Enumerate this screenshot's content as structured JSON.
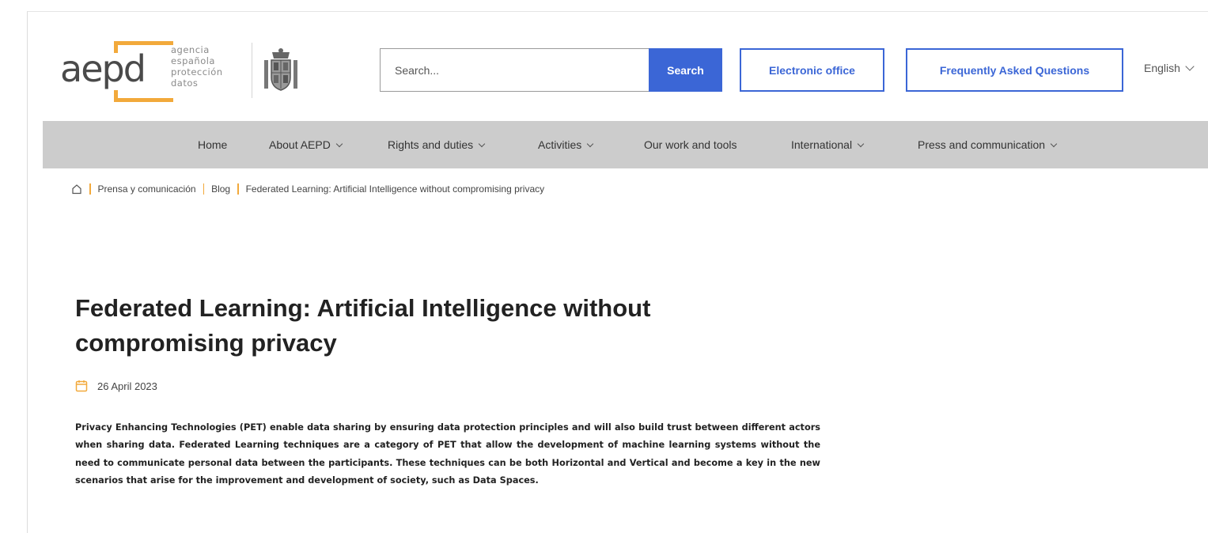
{
  "header": {
    "logo": {
      "word": "aepd",
      "tagline": [
        "agencia",
        "española",
        "protección",
        "datos"
      ]
    },
    "search": {
      "placeholder": "Search...",
      "button_label": "Search"
    },
    "electronic_office_label": "Electronic office",
    "faq_label": "Frequently Asked Questions",
    "language": "English"
  },
  "nav": {
    "items": [
      {
        "label": "Home",
        "dropdown": false
      },
      {
        "label": "About AEPD",
        "dropdown": true
      },
      {
        "label": "Rights and duties",
        "dropdown": true
      },
      {
        "label": "Activities",
        "dropdown": true
      },
      {
        "label": "Our work and tools",
        "dropdown": false
      },
      {
        "label": "International",
        "dropdown": true
      },
      {
        "label": "Press and communication",
        "dropdown": true
      }
    ]
  },
  "breadcrumb": {
    "items": [
      "Prensa y comunicación",
      "Blog",
      "Federated Learning: Artificial Intelligence without compromising privacy"
    ]
  },
  "article": {
    "title": "Federated Learning: Artificial Intelligence without compromising privacy",
    "date": "26 April 2023",
    "body": "Privacy Enhancing Technologies (PET) enable data sharing by ensuring data protection principles and will also build trust between different actors when sharing data.  Federated Learning techniques are a category of PET that allow the development of machine learning systems without the need to communicate personal data between the participants. These techniques can be both Horizontal and Vertical and become a key in the new scenarios that arise for the improvement and development of society, such as Data Spaces."
  },
  "colors": {
    "accent_blue": "#3b66d6",
    "logo_orange": "#f2a93b",
    "nav_background": "#cccccc"
  }
}
